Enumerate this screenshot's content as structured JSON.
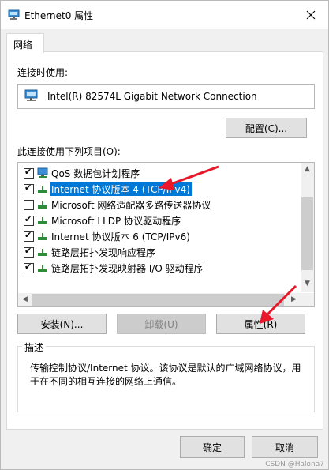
{
  "window": {
    "title": "Ethernet0 属性"
  },
  "tab": {
    "label": "网络"
  },
  "connect_using": {
    "label": "连接时使用:",
    "adapter": "Intel(R) 82574L Gigabit Network Connection",
    "configure_button": "配置(C)..."
  },
  "items_label": "此连接使用下列项目(O):",
  "items": [
    {
      "label": "QoS 数据包计划程序",
      "checked": true
    },
    {
      "label": "Internet 协议版本 4 (TCP/IPv4)",
      "checked": true,
      "selected": true
    },
    {
      "label": "Microsoft 网络适配器多路传送器协议",
      "checked": false
    },
    {
      "label": "Microsoft LLDP 协议驱动程序",
      "checked": true
    },
    {
      "label": "Internet 协议版本 6 (TCP/IPv6)",
      "checked": true
    },
    {
      "label": "链路层拓扑发现响应程序",
      "checked": true
    },
    {
      "label": "链路层拓扑发现映射器 I/O 驱动程序",
      "checked": true
    }
  ],
  "buttons": {
    "install": "安装(N)...",
    "uninstall": "卸载(U)",
    "properties": "属性(R)",
    "ok": "确定",
    "cancel": "取消"
  },
  "description": {
    "legend": "描述",
    "text": "传输控制协议/Internet 协议。该协议是默认的广域网络协议，用于在不同的相互连接的网络上通信。"
  },
  "watermark": "CSDN @Halona7",
  "colors": {
    "selection": "#0078d7",
    "annotation_arrow": "#e8182a"
  }
}
